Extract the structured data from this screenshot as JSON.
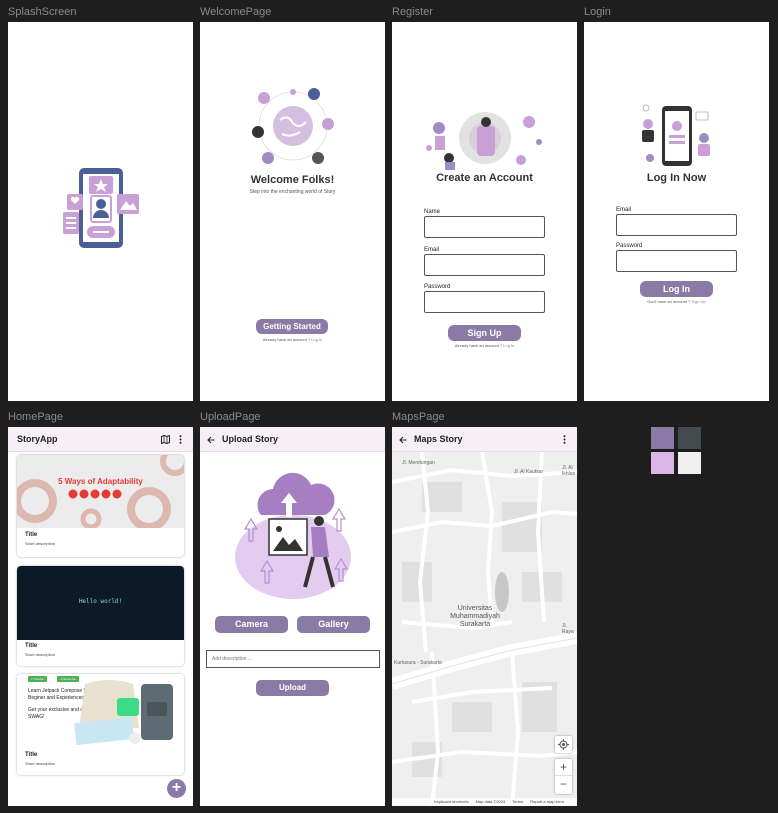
{
  "frames": {
    "splash": "SplashScreen",
    "welcome": "WelcomePage",
    "register": "Register",
    "login": "Login",
    "home": "HomePage",
    "upload": "UploadPage",
    "maps": "MapsPage"
  },
  "welcome": {
    "title": "Welcome Folks!",
    "subtitle": "Step into the enchanting world of Story",
    "button": "Getting Started",
    "footer_text": "Already have an account ?",
    "footer_link": "Log in"
  },
  "register": {
    "title": "Create an Account",
    "name_label": "Name",
    "email_label": "Email",
    "password_label": "Password",
    "button": "Sign Up",
    "footer_text": "Already have an account ?",
    "footer_link": "Log in"
  },
  "login": {
    "title": "Log In Now",
    "email_label": "Email",
    "password_label": "Password",
    "button": "Log In",
    "footer_text": "Don't have an account ?",
    "footer_link": "Sign Up"
  },
  "home": {
    "app_title": "StoryApp",
    "cards": [
      {
        "banner": "5 Ways of Adaptability",
        "title": "Title",
        "desc": "Short description"
      },
      {
        "code": "Hello world!",
        "title": "Title",
        "desc": "Short description"
      },
      {
        "tag1": "7 October",
        "tag2": "4 November",
        "headline": "Learn Jetpack Compose for Beginer and Experienced.",
        "promo": "Get your exclusive and adorable SWAG!",
        "title": "Title",
        "desc": "Short description"
      }
    ],
    "fab_symbol": "+"
  },
  "upload": {
    "title": "Upload Story",
    "camera": "Camera",
    "gallery": "Gallery",
    "placeholder": "Add description ...",
    "upload": "Upload"
  },
  "maps": {
    "title": "Maps Story",
    "labels": {
      "street1": "Jl. Mendungan",
      "street2": "Jl. Al Kautsar",
      "street3": "Jl. Al Ikhlas",
      "campus": "Universitas Muhammadiyah Surakarta",
      "road": "Jl. Raya",
      "street4": "Kartasura - Surakarta"
    },
    "zoom_in": "+",
    "zoom_out": "−",
    "footer": [
      "Keyboard shortcuts",
      "Map data ©2023",
      "Terms",
      "Report a map error"
    ]
  },
  "palette": [
    "#8b7aa6",
    "#43494d",
    "#dcb6e6",
    "#efefef"
  ]
}
